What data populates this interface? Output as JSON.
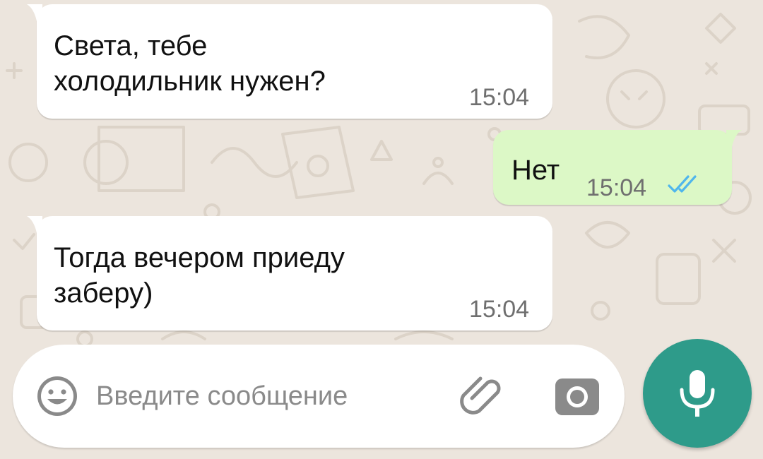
{
  "messages": [
    {
      "direction": "incoming",
      "text": "Света, тебе\nхолодильник нужен?",
      "time": "15:04"
    },
    {
      "direction": "outgoing",
      "text": "Нет",
      "time": "15:04",
      "status": "read",
      "status_icon": "double-check-icon"
    },
    {
      "direction": "incoming",
      "text": "Тогда вечером приеду\nзаберу)",
      "time": "15:04"
    }
  ],
  "composer": {
    "placeholder": "Введите сообщение",
    "value": "",
    "emoji_icon": "emoji-icon",
    "attach_icon": "paperclip-icon",
    "camera_icon": "camera-icon"
  },
  "mic_button": {
    "icon": "microphone-icon"
  },
  "colors": {
    "chat_background": "#ECE5DD",
    "incoming_bubble": "#FFFFFF",
    "outgoing_bubble": "#DCF8C6",
    "read_ticks": "#4FB6EC",
    "accent": "#2E9B8A"
  }
}
